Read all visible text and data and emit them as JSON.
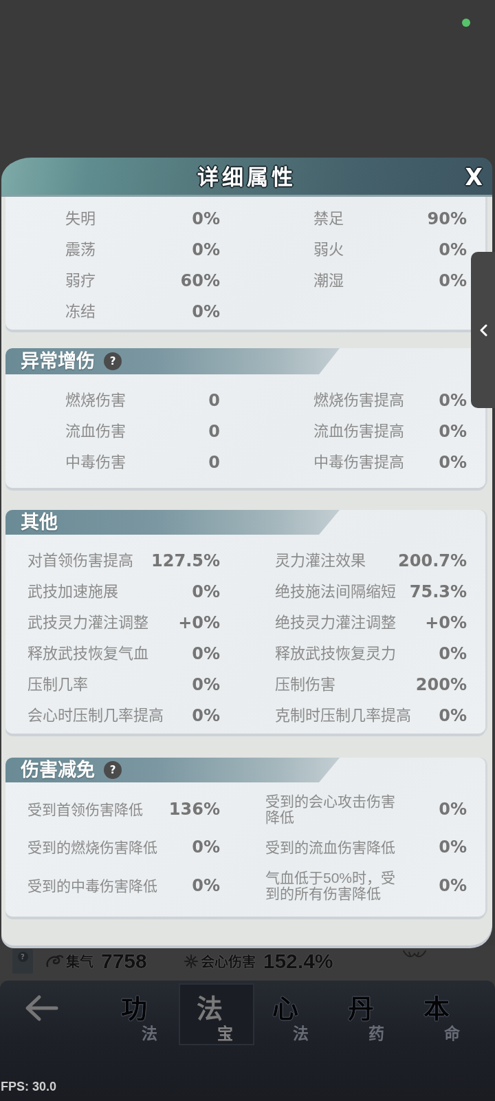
{
  "dialog": {
    "title": "详细属性",
    "close": "X"
  },
  "sections": [
    {
      "stats": [
        {
          "label": "失明",
          "value": "0%"
        },
        {
          "label": "禁足",
          "value": "90%"
        },
        {
          "label": "震荡",
          "value": "0%"
        },
        {
          "label": "弱火",
          "value": "0%"
        },
        {
          "label": "弱疗",
          "value": "60%"
        },
        {
          "label": "潮湿",
          "value": "0%"
        },
        {
          "label": "冻结",
          "value": "0%"
        }
      ]
    },
    {
      "title": "异常增伤",
      "help": "?",
      "stats": [
        {
          "label": "燃烧伤害",
          "value": "0"
        },
        {
          "label": "燃烧伤害提高",
          "value": "0%"
        },
        {
          "label": "流血伤害",
          "value": "0"
        },
        {
          "label": "流血伤害提高",
          "value": "0%"
        },
        {
          "label": "中毒伤害",
          "value": "0"
        },
        {
          "label": "中毒伤害提高",
          "value": "0%"
        }
      ]
    },
    {
      "title": "其他",
      "stats": [
        {
          "label": "对首领伤害提高",
          "value": "127.5%"
        },
        {
          "label": "灵力灌注效果",
          "value": "200.7%"
        },
        {
          "label": "武技加速施展",
          "value": "0%"
        },
        {
          "label": "绝技施法间隔缩短",
          "value": "75.3%"
        },
        {
          "label": "武技灵力灌注调整",
          "value": "+0%"
        },
        {
          "label": "绝技灵力灌注调整",
          "value": "+0%"
        },
        {
          "label": "释放武技恢复气血",
          "value": "0%"
        },
        {
          "label": "释放武技恢复灵力",
          "value": "0%"
        },
        {
          "label": "压制几率",
          "value": "0%"
        },
        {
          "label": "压制伤害",
          "value": "200%"
        },
        {
          "label": "会心时压制几率提高",
          "value": "0%"
        },
        {
          "label": "克制时压制几率提高",
          "value": "0%"
        }
      ]
    },
    {
      "title": "伤害减免",
      "help": "?",
      "stats": [
        {
          "label": "受到首领伤害降低",
          "value": "136%"
        },
        {
          "label": "受到的会心攻击伤害降低",
          "value": "0%"
        },
        {
          "label": "受到的燃烧伤害降低",
          "value": "0%"
        },
        {
          "label": "受到的流血伤害降低",
          "value": "0%"
        },
        {
          "label": "受到的中毒伤害降低",
          "value": "0%"
        },
        {
          "label": "气血低于50%时，受到的所有伤害降低",
          "value": "0%"
        }
      ]
    }
  ],
  "background_stats": {
    "help": "?",
    "items": [
      {
        "label": "集气",
        "value": "7758"
      },
      {
        "label": "会心伤害",
        "value": "152.4%"
      }
    ]
  },
  "nav": {
    "tabs": [
      {
        "main": "功",
        "sub": "法",
        "selected": false
      },
      {
        "main": "法",
        "sub": "宝",
        "selected": true
      },
      {
        "main": "心",
        "sub": "法",
        "selected": false
      },
      {
        "main": "丹",
        "sub": "药",
        "selected": false
      },
      {
        "main": "本",
        "sub": "命",
        "selected": false
      }
    ]
  },
  "fps": "FPS: 30.0"
}
